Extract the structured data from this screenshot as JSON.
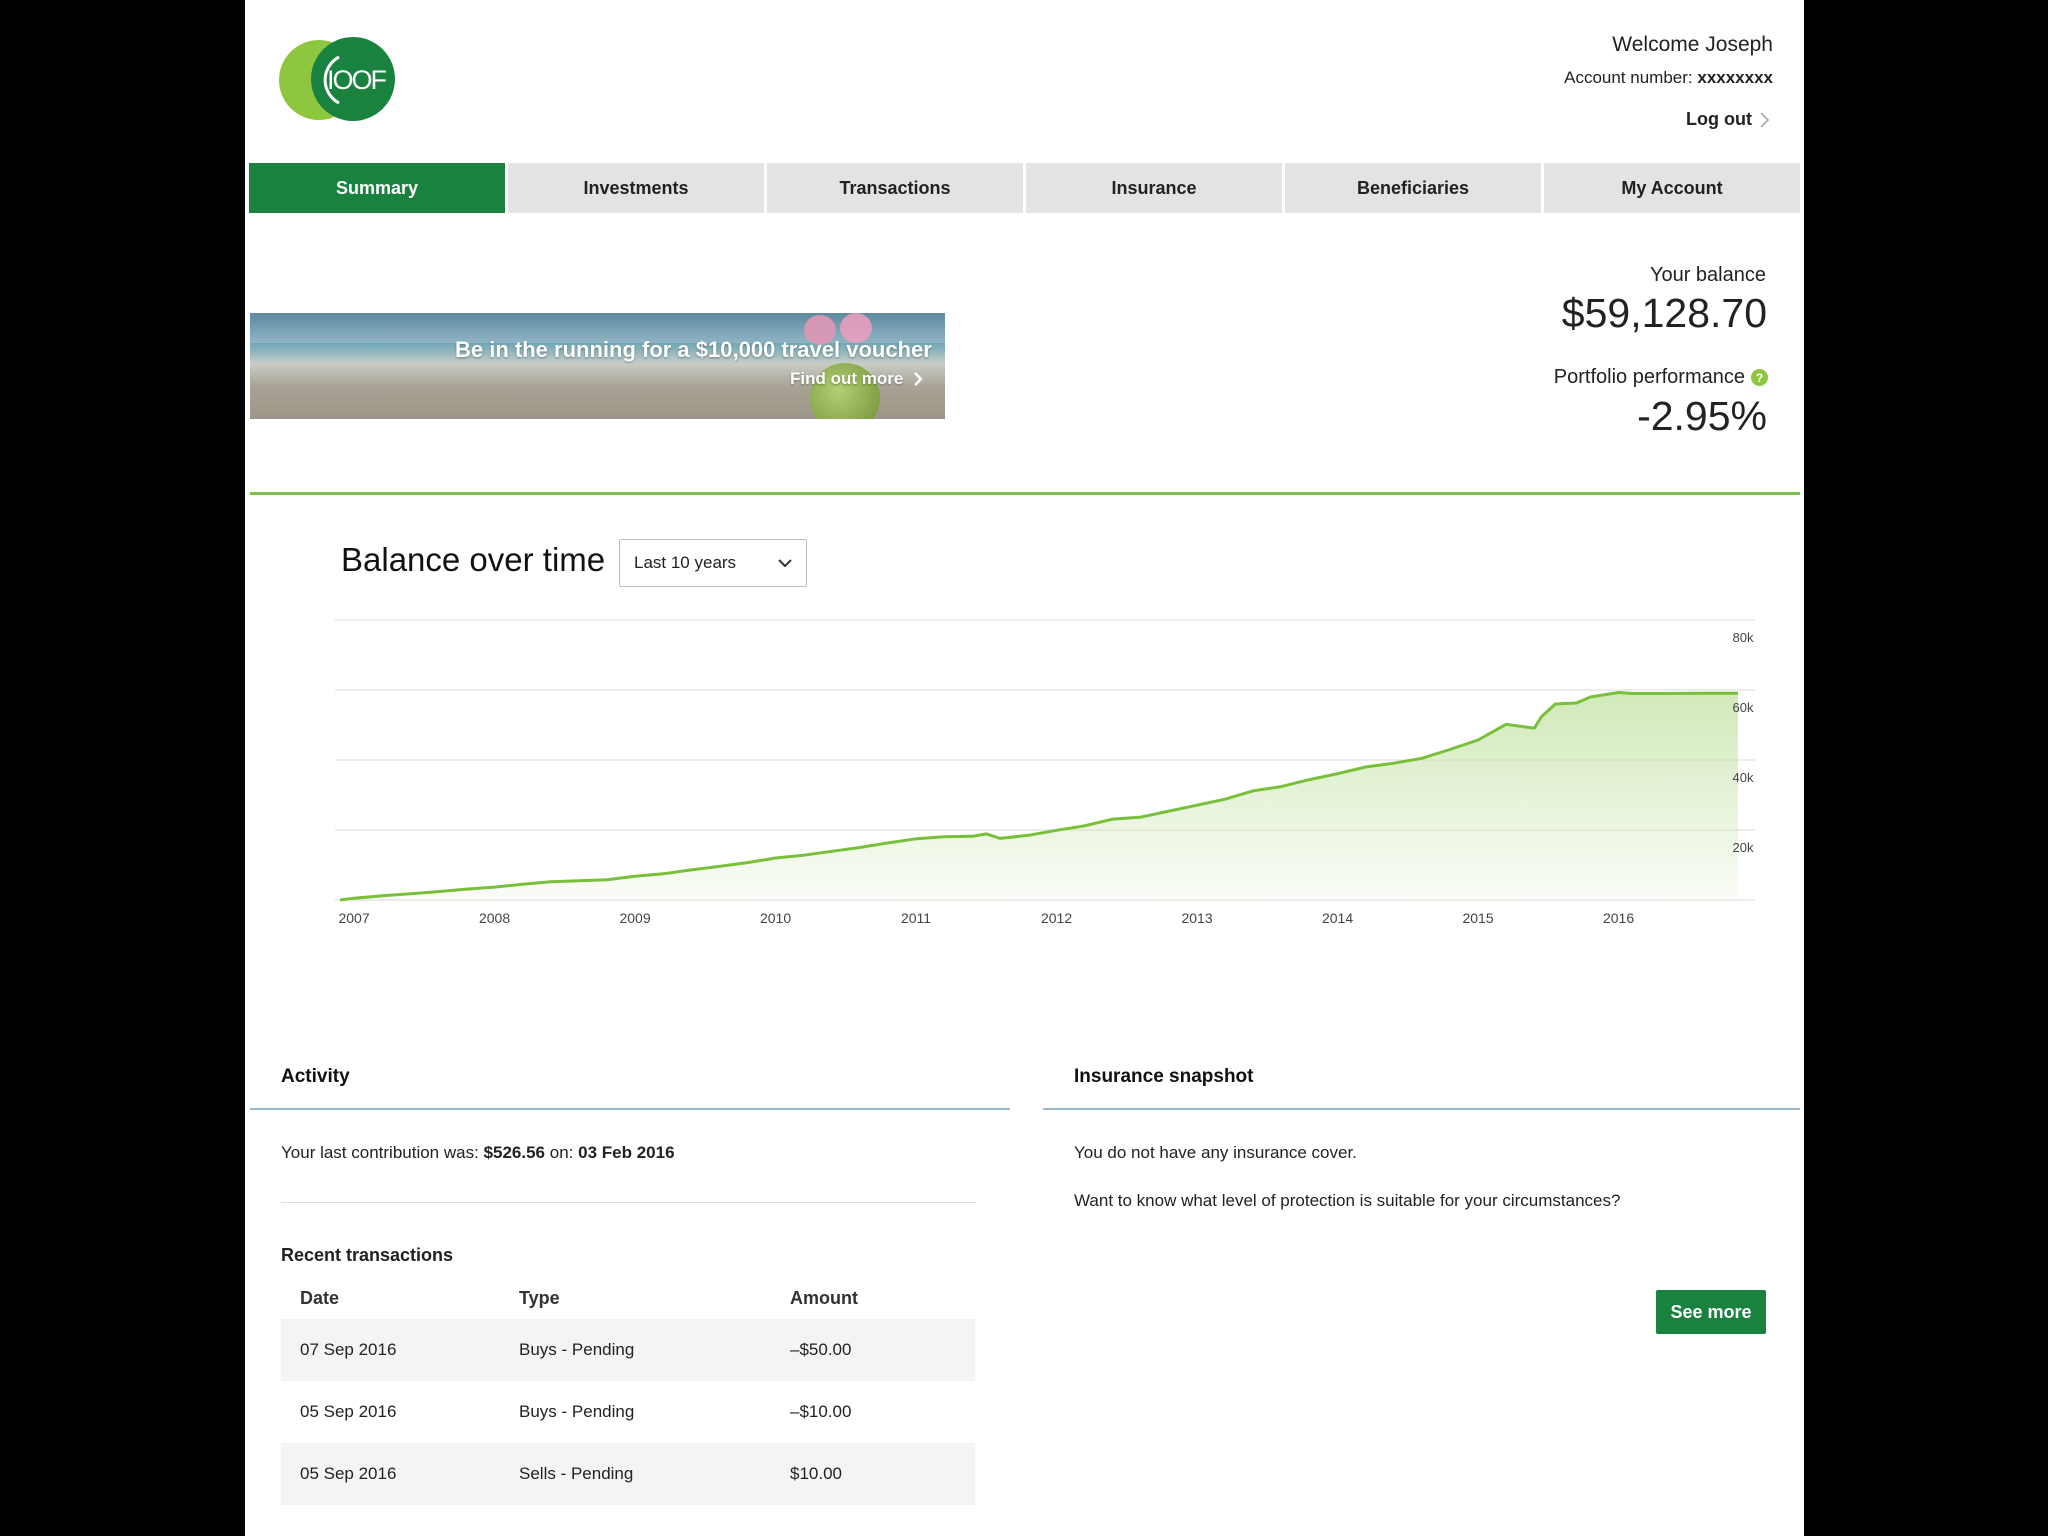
{
  "brand": {
    "logo_text": "IOOF",
    "primary_color": "#19823f",
    "accent_color": "#8dc63f"
  },
  "header": {
    "welcome": "Welcome Joseph",
    "account_label": "Account number:",
    "account_number": "xxxxxxxx",
    "logout": "Log out"
  },
  "nav": {
    "tabs": [
      {
        "label": "Summary",
        "active": true
      },
      {
        "label": "Investments",
        "active": false
      },
      {
        "label": "Transactions",
        "active": false
      },
      {
        "label": "Insurance",
        "active": false
      },
      {
        "label": "Beneficiaries",
        "active": false
      },
      {
        "label": "My Account",
        "active": false
      }
    ]
  },
  "banner": {
    "title": "Be in the running for a $10,000 travel voucher",
    "cta": "Find out more"
  },
  "balance": {
    "label": "Your balance",
    "value": "$59,128.70",
    "performance_label": "Portfolio performance",
    "help_icon": "?",
    "performance_value": "-2.95%"
  },
  "chart_section": {
    "title": "Balance over time",
    "range": "Last 10 years"
  },
  "chart_data": {
    "type": "area",
    "x_tick_labels": [
      "2007",
      "2008",
      "2009",
      "2010",
      "2011",
      "2012",
      "2013",
      "2014",
      "2015",
      "2016"
    ],
    "y_tick_labels": [
      "80k",
      "60k",
      "40k",
      "20k"
    ],
    "ylim": [
      0,
      80000
    ],
    "xlim": [
      2006.9,
      2016.85
    ],
    "grid": true,
    "color": "#78bf3a",
    "fill_color": "#cfe8b5",
    "x": [
      2006.9,
      2007.0,
      2007.2,
      2007.4,
      2007.6,
      2007.8,
      2008.0,
      2008.2,
      2008.4,
      2008.6,
      2008.8,
      2009.0,
      2009.2,
      2009.4,
      2009.6,
      2009.8,
      2010.0,
      2010.2,
      2010.4,
      2010.6,
      2010.8,
      2011.0,
      2011.2,
      2011.4,
      2011.5,
      2011.6,
      2011.8,
      2012.0,
      2012.2,
      2012.4,
      2012.6,
      2012.8,
      2013.0,
      2013.2,
      2013.4,
      2013.6,
      2013.8,
      2014.0,
      2014.2,
      2014.4,
      2014.6,
      2014.8,
      2015.0,
      2015.2,
      2015.4,
      2015.45,
      2015.55,
      2015.7,
      2015.8,
      2016.0,
      2016.1,
      2016.3,
      2016.6,
      2016.85
    ],
    "y": [
      0,
      500,
      1200,
      1800,
      2400,
      3100,
      3700,
      4500,
      5200,
      5500,
      5800,
      6800,
      7500,
      8600,
      9600,
      10700,
      12000,
      12800,
      13900,
      15000,
      16300,
      17500,
      18100,
      18200,
      18900,
      17600,
      18500,
      19900,
      21200,
      23100,
      23700,
      25400,
      27100,
      28800,
      31200,
      32400,
      34400,
      36100,
      38000,
      39100,
      40500,
      43000,
      45700,
      50200,
      49100,
      52300,
      56000,
      56300,
      58000,
      59300,
      59000,
      59000,
      59100,
      59100
    ]
  },
  "activity": {
    "title": "Activity",
    "contribution_prefix": "Your last contribution was:",
    "contribution_amount": "$526.56",
    "contribution_on": "on:",
    "contribution_date": "03 Feb 2016",
    "recent_title": "Recent transactions",
    "columns": [
      "Date",
      "Type",
      "Amount"
    ],
    "rows": [
      {
        "date": "07 Sep 2016",
        "type": "Buys - Pending",
        "amount": "–$50.00"
      },
      {
        "date": "05 Sep 2016",
        "type": "Buys - Pending",
        "amount": "–$10.00"
      },
      {
        "date": "05 Sep 2016",
        "type": "Sells - Pending",
        "amount": "$10.00"
      }
    ]
  },
  "insurance": {
    "title": "Insurance snapshot",
    "line1": "You do not have any insurance cover.",
    "line2": "Want to know what level of protection is suitable for your circumstances?",
    "button": "See more"
  }
}
